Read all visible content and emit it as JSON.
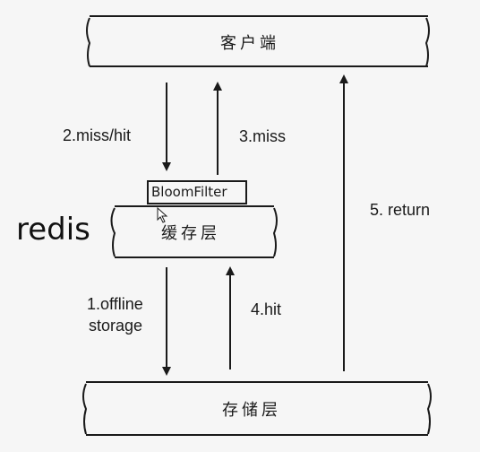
{
  "boxes": {
    "client": "客户端",
    "cache": "缓存层",
    "storage": "存储层",
    "bloom": "BloomFilter"
  },
  "side_label": "redis",
  "edges": {
    "e1_line1": "1.offline",
    "e1_line2": "storage",
    "e2": "2.miss/hit",
    "e3": "3.miss",
    "e4": "4.hit",
    "e5": "5. return"
  },
  "colors": {
    "background": "#f6f6f6",
    "stroke": "#1a1a1a"
  }
}
